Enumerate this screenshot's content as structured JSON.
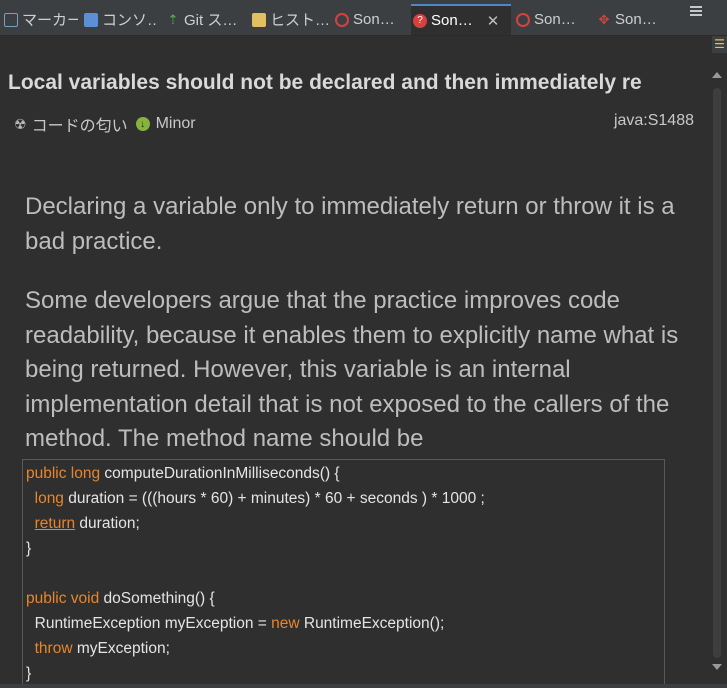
{
  "tabs": [
    {
      "label": "マーカー",
      "icon": "markers-icon",
      "icon_color": "#7a9cc6"
    },
    {
      "label": "コンソ…",
      "icon": "console-icon",
      "icon_color": "#5b8fd6"
    },
    {
      "label": "Git ス…",
      "icon": "git-staging-icon",
      "icon_color": "#5fae5f"
    },
    {
      "label": "ヒスト…",
      "icon": "history-icon",
      "icon_color": "#e0c060"
    },
    {
      "label": "Son…",
      "icon": "sonarlint-issues-icon",
      "icon_color": "#d84040"
    },
    {
      "label": "Son…",
      "icon": "sonarlint-rule-description-icon",
      "icon_color": "#d84040",
      "active": true
    },
    {
      "label": "Son…",
      "icon": "sonarlint-taint-icon",
      "icon_color": "#d84040"
    },
    {
      "label": "Son…",
      "icon": "sonarlint-hotspots-icon",
      "icon_color": "#d84040"
    }
  ],
  "tab_close": "✕",
  "rule": {
    "title": "Local variables should not be declared and then immediately re",
    "type": "コードの匂い",
    "severity": "Minor",
    "key": "java:S1488"
  },
  "description": {
    "paragraph1": "Declaring a variable only to immediately return or throw it is a bad practice.",
    "paragraph2": "Some developers argue that the practice improves code readability, because it enables them to explicitly name what is being returned. However, this variable is an internal implementation detail that is not exposed to the callers of the method. The method name should be"
  },
  "code": {
    "l1_kw": "public long",
    "l1_rest": " computeDurationInMilliseconds() {",
    "l2_kw": "long",
    "l2_rest": " duration = (((hours * 60) + minutes) * 60 + seconds ) * 1000 ;",
    "l3_kw": "return",
    "l3_rest": " duration;",
    "l4": "}",
    "l6_kw": "public void",
    "l6_rest": " doSomething() {",
    "l7_a": "RuntimeException myException = ",
    "l7_kw": "new",
    "l7_b": " RuntimeException();",
    "l8_kw": "throw",
    "l8_rest": " myException;",
    "l9": "}"
  },
  "colors": {
    "keyword": "#e8852c",
    "background": "#2f2f2f",
    "active_tab_accent": "#4a88c7"
  }
}
